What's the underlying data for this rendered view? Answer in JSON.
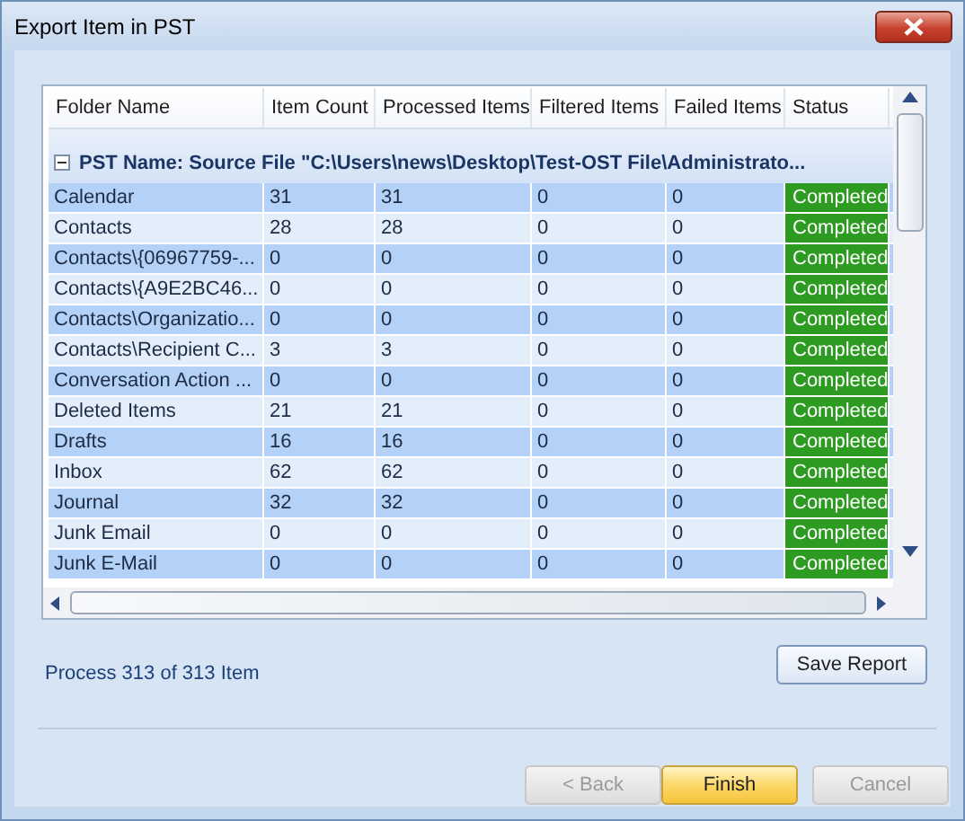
{
  "window": {
    "title": "Export Item in PST"
  },
  "table": {
    "columns": [
      "Folder Name",
      "Item Count",
      "Processed Items",
      "Filtered Items",
      "Failed Items",
      "Status"
    ],
    "group": {
      "label": "PST Name: Source File \"C:\\Users\\news\\Desktop\\Test-OST File\\Administrato...",
      "expanded": true
    },
    "rows": [
      {
        "cells": [
          "Calendar",
          "31",
          "31",
          "0",
          "0",
          "Completed"
        ]
      },
      {
        "cells": [
          "Contacts",
          "28",
          "28",
          "0",
          "0",
          "Completed"
        ]
      },
      {
        "cells": [
          "Contacts\\{06967759-...",
          "0",
          "0",
          "0",
          "0",
          "Completed"
        ]
      },
      {
        "cells": [
          "Contacts\\{A9E2BC46...",
          "0",
          "0",
          "0",
          "0",
          "Completed"
        ]
      },
      {
        "cells": [
          "Contacts\\Organizatio...",
          "0",
          "0",
          "0",
          "0",
          "Completed"
        ]
      },
      {
        "cells": [
          "Contacts\\Recipient C...",
          "3",
          "3",
          "0",
          "0",
          "Completed"
        ]
      },
      {
        "cells": [
          "Conversation Action ...",
          "0",
          "0",
          "0",
          "0",
          "Completed"
        ]
      },
      {
        "cells": [
          "Deleted Items",
          "21",
          "21",
          "0",
          "0",
          "Completed"
        ]
      },
      {
        "cells": [
          "Drafts",
          "16",
          "16",
          "0",
          "0",
          "Completed"
        ]
      },
      {
        "cells": [
          "Inbox",
          "62",
          "62",
          "0",
          "0",
          "Completed"
        ]
      },
      {
        "cells": [
          "Journal",
          "32",
          "32",
          "0",
          "0",
          "Completed"
        ]
      },
      {
        "cells": [
          "Junk Email",
          "0",
          "0",
          "0",
          "0",
          "Completed"
        ]
      },
      {
        "cells": [
          "Junk E-Mail",
          "0",
          "0",
          "0",
          "0",
          "Completed"
        ]
      }
    ]
  },
  "progress_text": "Process 313 of 313 Item",
  "save_button": {
    "label": "Save Report",
    "disabled": false
  },
  "buttons": [
    {
      "label": "< Back",
      "disabled": true,
      "highlighted": false
    },
    {
      "label": "Finish",
      "disabled": false,
      "highlighted": true
    },
    {
      "label": "Cancel",
      "disabled": true,
      "highlighted": false
    }
  ]
}
